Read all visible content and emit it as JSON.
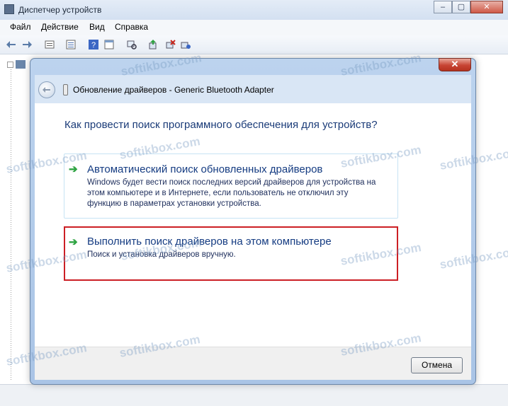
{
  "window": {
    "title": "Диспетчер устройств",
    "min": "–",
    "max": "▢",
    "close": "✕"
  },
  "menu": [
    "Файл",
    "Действие",
    "Вид",
    "Справка"
  ],
  "toolbar_icons": [
    "back-arrow-icon",
    "forward-arrow-icon",
    "properties-icon",
    "device-list-icon",
    "help-icon",
    "view-icon",
    "scan-hardware-icon",
    "update-driver-icon",
    "disable-device-icon",
    "uninstall-device-icon"
  ],
  "dialog": {
    "title": "Обновление драйверов - Generic Bluetooth Adapter",
    "question": "Как провести поиск программного обеспечения для устройств?",
    "option1": {
      "title": "Автоматический поиск обновленных драйверов",
      "desc_line1": "Windows будет вести поиск последних версий драйверов для устройства на",
      "desc_line2": "этом компьютере и в Интернете, если пользователь не отключил эту",
      "desc_line3": "функцию в параметрах установки устройства."
    },
    "option2": {
      "title": "Выполнить поиск драйверов на этом компьютере",
      "desc": "Поиск и установка драйверов вручную."
    },
    "cancel": "Отмена",
    "close": "✕",
    "arrow": "➔"
  },
  "watermark": "softikbox.com",
  "colors": {
    "highlight_border": "#cc1f25",
    "arrow_green": "#2ea342",
    "link_blue": "#153c82"
  }
}
